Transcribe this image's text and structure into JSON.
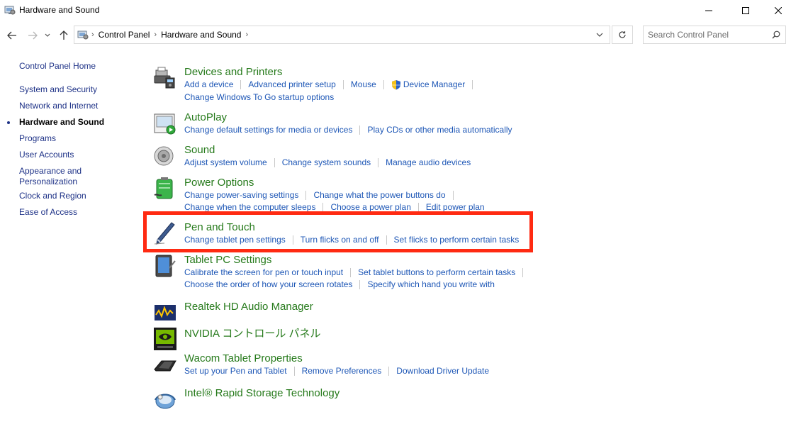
{
  "window": {
    "title": "Hardware and Sound",
    "icons": [
      "control-panel-icon",
      "minimize-icon",
      "maximize-icon",
      "close-icon"
    ]
  },
  "navigation": {
    "breadcrumbs": [
      "Control Panel",
      "Hardware and Sound"
    ],
    "search_placeholder": "Search Control Panel"
  },
  "sidebar": {
    "home": "Control Panel Home",
    "items": [
      "System and Security",
      "Network and Internet",
      "Hardware and Sound",
      "Programs",
      "User Accounts",
      "Appearance and",
      "Personalization",
      "Clock and Region",
      "Ease of Access"
    ]
  },
  "categories": {
    "devices": {
      "title": "Devices and Printers",
      "links": [
        "Add a device",
        "Advanced printer setup",
        "Mouse",
        "Device Manager",
        "Change Windows To Go startup options"
      ]
    },
    "autoplay": {
      "title": "AutoPlay",
      "links": [
        "Change default settings for media or devices",
        "Play CDs or other media automatically"
      ]
    },
    "sound": {
      "title": "Sound",
      "links": [
        "Adjust system volume",
        "Change system sounds",
        "Manage audio devices"
      ]
    },
    "power": {
      "title": "Power Options",
      "links": [
        "Change power-saving settings",
        "Change what the power buttons do",
        "Change when the computer sleeps",
        "Choose a power plan",
        "Edit power plan"
      ]
    },
    "pen": {
      "title": "Pen and Touch",
      "links": [
        "Change tablet pen settings",
        "Turn flicks on and off",
        "Set flicks to perform certain tasks"
      ]
    },
    "tablet": {
      "title": "Tablet PC Settings",
      "links": [
        "Calibrate the screen for pen or touch input",
        "Set tablet buttons to perform certain tasks",
        "Choose the order of how your screen rotates",
        "Specify which hand you write with"
      ]
    },
    "realtek": {
      "title": "Realtek HD Audio Manager"
    },
    "nvidia": {
      "title": "NVIDIA コントロール パネル"
    },
    "wacom": {
      "title": "Wacom Tablet Properties",
      "links": [
        "Set up your Pen and Tablet",
        "Remove Preferences",
        "Download Driver Update"
      ]
    },
    "intel": {
      "title": "Intel® Rapid Storage Technology"
    }
  },
  "colors": {
    "category_title": "#267a1b",
    "link": "#1e57b6",
    "sidebar_link": "#1e3287",
    "highlight_box": "#ff2a12"
  }
}
